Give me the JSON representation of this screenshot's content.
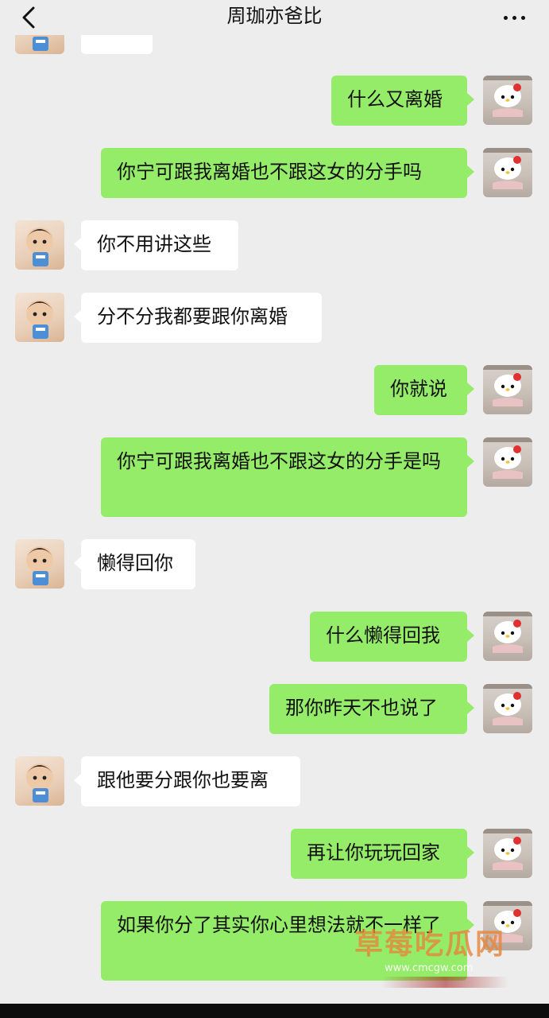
{
  "header": {
    "title": "周珈亦爸比",
    "back_icon": "chevron-left-icon",
    "more_icon": "more-dots-icon"
  },
  "messages": [
    {
      "side": "left",
      "text": ""
    },
    {
      "side": "right",
      "text": "什么又离婚"
    },
    {
      "side": "right",
      "text": "你宁可跟我离婚也不跟这女的分手吗"
    },
    {
      "side": "left",
      "text": "你不用讲这些"
    },
    {
      "side": "left",
      "text": "分不分我都要跟你离婚"
    },
    {
      "side": "right",
      "text": "你就说"
    },
    {
      "side": "right",
      "text": "你宁可跟我离婚也不跟这女的分手是吗"
    },
    {
      "side": "left",
      "text": "懒得回你"
    },
    {
      "side": "right",
      "text": "什么懒得回我"
    },
    {
      "side": "right",
      "text": "那你昨天不也说了"
    },
    {
      "side": "left",
      "text": "跟他要分跟你也要离"
    },
    {
      "side": "right",
      "text": "再让你玩玩回家"
    },
    {
      "side": "right",
      "text": "如果你分了其实你心里想法就不一样了"
    }
  ],
  "watermark": {
    "title": "草莓吃瓜网",
    "url": "www.cmcgw.com"
  },
  "colors": {
    "background": "#ededed",
    "bubble_green": "#95ec69",
    "bubble_white": "#ffffff"
  }
}
